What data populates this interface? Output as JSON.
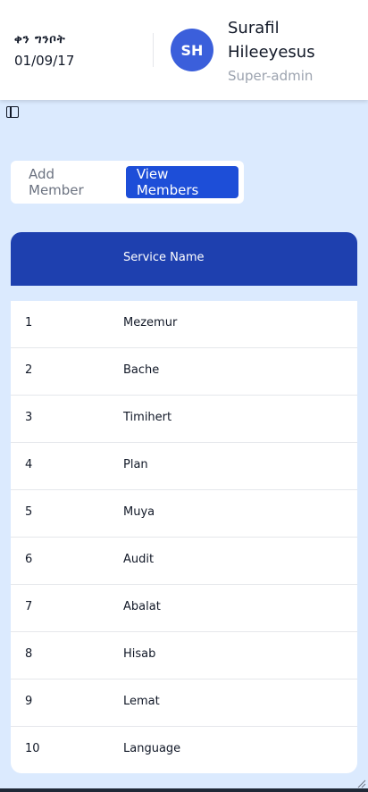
{
  "header": {
    "date_label": "ቀን ግንቦት",
    "date_value": "01/09/17",
    "avatar_initials": "SH",
    "user_name_first": "Surafil",
    "user_name_last": "Hileeyesus",
    "user_role": "Super-admin"
  },
  "tabs": {
    "add_member": "Add Member",
    "view_members": "View Members"
  },
  "table": {
    "column_service_name": "Service Name",
    "rows": [
      {
        "num": "1",
        "name": "Mezemur"
      },
      {
        "num": "2",
        "name": "Bache"
      },
      {
        "num": "3",
        "name": "Timihert"
      },
      {
        "num": "4",
        "name": "Plan"
      },
      {
        "num": "5",
        "name": "Muya"
      },
      {
        "num": "6",
        "name": "Audit"
      },
      {
        "num": "7",
        "name": "Abalat"
      },
      {
        "num": "8",
        "name": "Hisab"
      },
      {
        "num": "9",
        "name": "Lemat"
      },
      {
        "num": "10",
        "name": "Language"
      }
    ]
  },
  "colors": {
    "background": "#dbeafe",
    "accent": "#1d4ed8",
    "table_header": "#1e40af",
    "avatar": "#3b5fdb"
  },
  "icons": {
    "sidebar_toggle": "sidebar-toggle-icon",
    "resize": "resize-handle-icon"
  }
}
